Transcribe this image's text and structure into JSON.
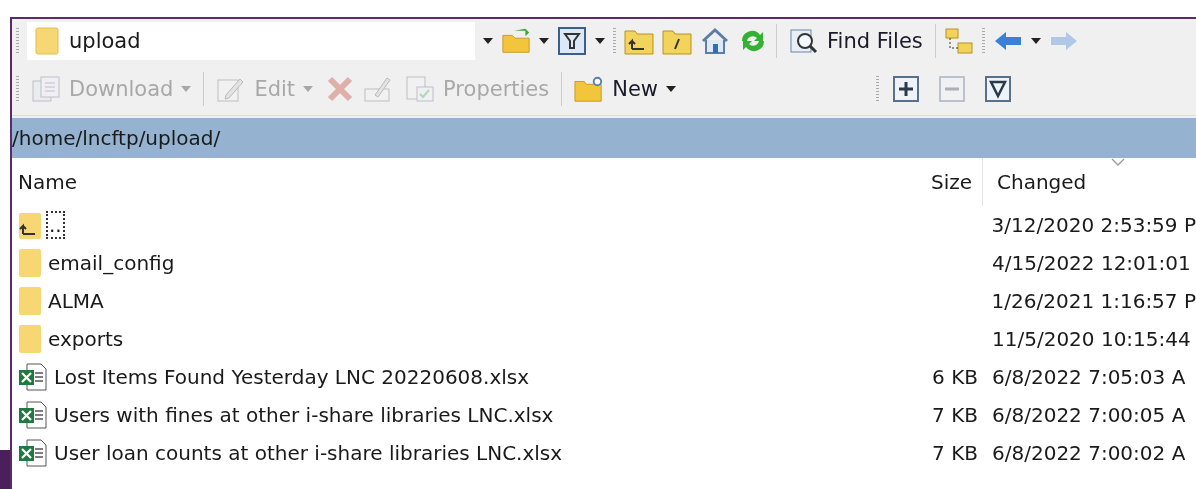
{
  "address_box": {
    "value": "upload"
  },
  "toolbar_1": {
    "find_files": {
      "label": "Find Files"
    },
    "back": {
      "disabled": false
    },
    "forward": {
      "disabled": true
    }
  },
  "toolbar_2": {
    "download": {
      "label": "Download",
      "disabled": true
    },
    "edit": {
      "label": "Edit",
      "disabled": true
    },
    "delete": {
      "disabled": true
    },
    "rename": {
      "disabled": true
    },
    "properties": {
      "label": "Properties",
      "disabled": true
    },
    "new": {
      "label": "New",
      "disabled": false
    },
    "expand": {
      "disabled": false
    },
    "collapse": {
      "disabled": true
    },
    "filter": {
      "disabled": false
    }
  },
  "path_bar": "/home/lncftp/upload/",
  "table": {
    "columns": [
      "Name",
      "Size",
      "Changed"
    ],
    "rows": [
      {
        "kind": "parent",
        "name": "..",
        "size": "",
        "changed": "3/12/2020 2:53:59 P",
        "focused": true
      },
      {
        "kind": "folder",
        "name": "email_config",
        "size": "",
        "changed": "4/15/2022 12:01:01",
        "focused": false
      },
      {
        "kind": "folder",
        "name": "ALMA",
        "size": "",
        "changed": "1/26/2021 1:16:57 P",
        "focused": false
      },
      {
        "kind": "folder",
        "name": "exports",
        "size": "",
        "changed": "11/5/2020 10:15:44",
        "focused": false
      },
      {
        "kind": "xlsx",
        "name": "Lost Items Found Yesterday LNC 20220608.xlsx",
        "size": "6 KB",
        "changed": "6/8/2022 7:05:03 A",
        "focused": false
      },
      {
        "kind": "xlsx",
        "name": "Users with fines at other i-share libraries LNC.xlsx",
        "size": "7 KB",
        "changed": "6/8/2022 7:00:05 A",
        "focused": false
      },
      {
        "kind": "xlsx",
        "name": "User loan counts at other i-share libraries LNC.xlsx",
        "size": "7 KB",
        "changed": "6/8/2022 7:00:02 A",
        "focused": false
      }
    ]
  }
}
